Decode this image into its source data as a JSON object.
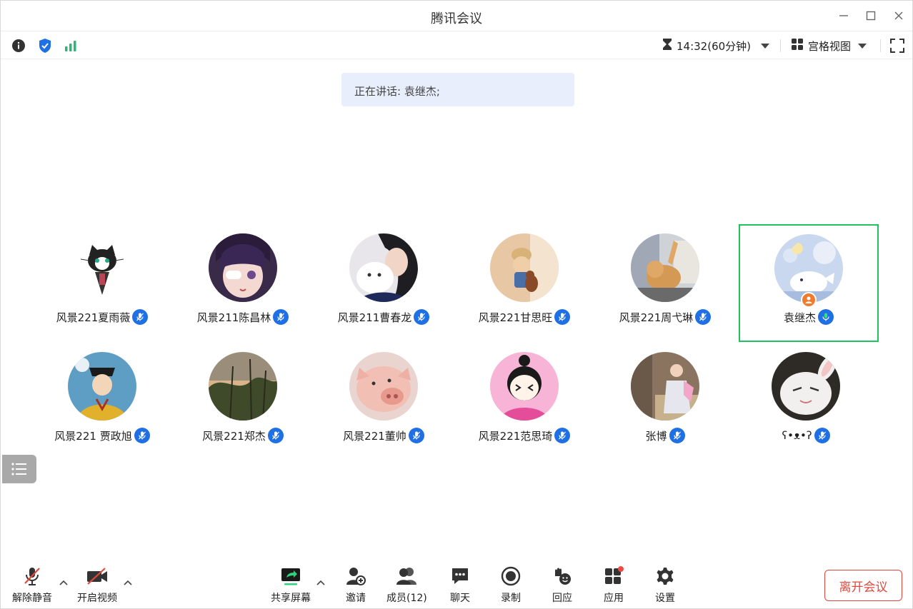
{
  "window": {
    "title": "腾讯会议"
  },
  "infobar": {
    "time": "14:32(60分钟)",
    "layout_label": "宫格视图"
  },
  "speaking": {
    "text": "正在讲话: 袁继杰;"
  },
  "participants": [
    {
      "name": "风景221夏雨薇",
      "mic": "muted"
    },
    {
      "name": "风景211陈昌林",
      "mic": "muted"
    },
    {
      "name": "风景211曹春龙",
      "mic": "muted"
    },
    {
      "name": "风景221甘思旺",
      "mic": "muted"
    },
    {
      "name": "风景221周弋琳",
      "mic": "muted"
    },
    {
      "name": "袁继杰",
      "mic": "active",
      "host": true
    },
    {
      "name": "风景221 贾政旭",
      "mic": "muted"
    },
    {
      "name": "风景221郑杰",
      "mic": "muted"
    },
    {
      "name": "风景221董帅",
      "mic": "muted"
    },
    {
      "name": "风景221范思琦",
      "mic": "muted"
    },
    {
      "name": "张博",
      "mic": "muted"
    },
    {
      "name": "ʕ•ᴥ•ʔ",
      "mic": "muted"
    }
  ],
  "toolbar": {
    "unmute": "解除静音",
    "video": "开启视频",
    "share": "共享屏幕",
    "invite": "邀请",
    "members": "成员(12)",
    "chat": "聊天",
    "record": "录制",
    "react": "回应",
    "apps": "应用",
    "settings": "设置",
    "leave": "离开会议"
  },
  "colors": {
    "accent_blue": "#1f6fe5",
    "active_green": "#22c35e",
    "leave_red": "#e0483d",
    "banner_bg": "#e8eefb"
  }
}
